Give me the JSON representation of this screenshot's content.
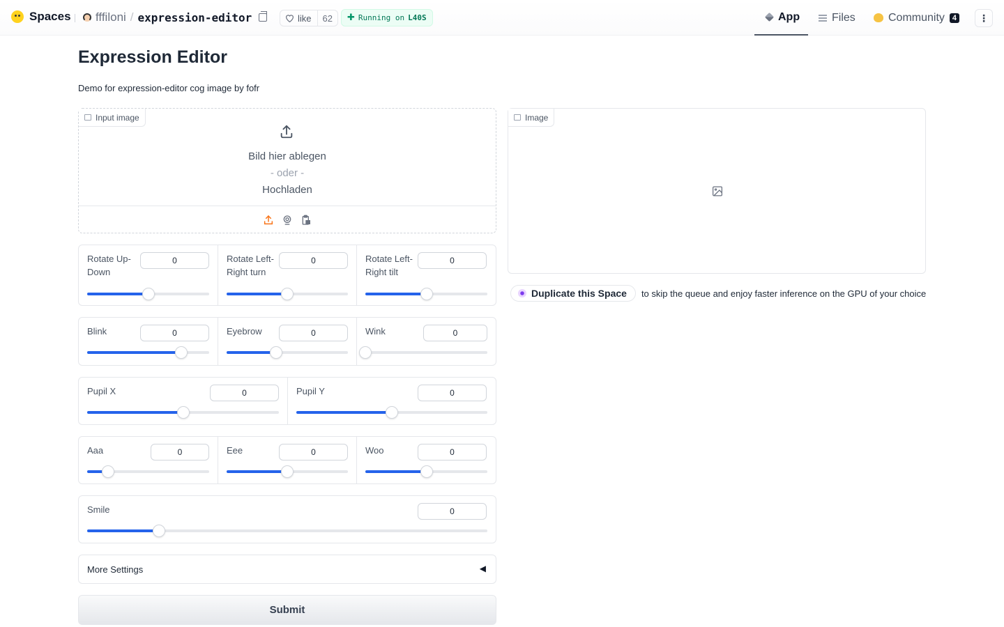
{
  "header": {
    "brand": "Spaces",
    "owner": "fffiloni",
    "separator": "/",
    "repo": "expression-editor",
    "like_label": "like",
    "like_count": "62",
    "status_prefix": "Running on",
    "status_hardware": "L40S",
    "tabs": [
      {
        "label": "App",
        "active": true
      },
      {
        "label": "Files",
        "active": false
      },
      {
        "label": "Community",
        "active": false,
        "count": "4"
      }
    ],
    "menu_glyph": "⋮"
  },
  "main": {
    "title": "Expression Editor",
    "description": "Demo for expression-editor cog image by fofr"
  },
  "input_image": {
    "label": "Input image",
    "drop_text": "Bild hier ablegen",
    "or_text": "- oder -",
    "upload_text": "Hochladen",
    "sources": [
      "upload-icon",
      "webcam-icon",
      "clipboard-icon"
    ]
  },
  "output_image": {
    "label": "Image",
    "placeholder_icon": "image-icon"
  },
  "duplicate": {
    "button": "Duplicate this Space",
    "text": "to skip the queue and enjoy faster inference on the GPU of your choice"
  },
  "sliders": {
    "rotate_up_down": {
      "label": "Rotate Up-Down",
      "value": "0",
      "fraction": 0.5
    },
    "rotate_lr_turn": {
      "label": "Rotate Left-Right turn",
      "value": "0",
      "fraction": 0.5
    },
    "rotate_lr_tilt": {
      "label": "Rotate Left-Right tilt",
      "value": "0",
      "fraction": 0.5
    },
    "blink": {
      "label": "Blink",
      "value": "0",
      "fraction": 0.77
    },
    "eyebrow": {
      "label": "Eyebrow",
      "value": "0",
      "fraction": 0.41
    },
    "wink": {
      "label": "Wink",
      "value": "0",
      "fraction": 0.0
    },
    "pupil_x": {
      "label": "Pupil X",
      "value": "0",
      "fraction": 0.5
    },
    "pupil_y": {
      "label": "Pupil Y",
      "value": "0",
      "fraction": 0.5
    },
    "aaa": {
      "label": "Aaa",
      "value": "0",
      "fraction": 0.17
    },
    "eee": {
      "label": "Eee",
      "value": "0",
      "fraction": 0.5
    },
    "woo": {
      "label": "Woo",
      "value": "0",
      "fraction": 0.5
    },
    "smile": {
      "label": "Smile",
      "value": "0",
      "fraction": 0.18
    }
  },
  "more_settings": {
    "label": "More Settings",
    "arrow": "◀"
  },
  "submit": {
    "label": "Submit"
  },
  "colors": {
    "accent": "#2563eb",
    "running_green": "#047857",
    "upload_orange": "#f97316"
  }
}
